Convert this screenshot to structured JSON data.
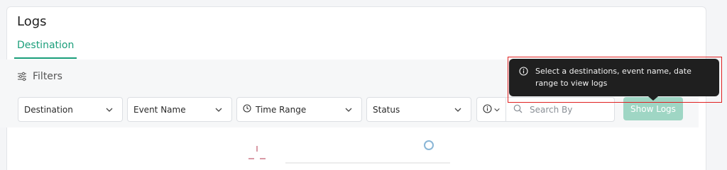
{
  "page": {
    "title": "Logs",
    "tabs": [
      {
        "label": "Destination",
        "active": true
      }
    ]
  },
  "filters": {
    "label": "Filters",
    "destination": {
      "value": "Destination"
    },
    "event_name": {
      "value": "Event Name"
    },
    "time_range": {
      "value": "Time Range"
    },
    "status": {
      "value": "Status"
    },
    "search": {
      "value": "",
      "placeholder": "Search By"
    },
    "show_logs_label": "Show Logs"
  },
  "tooltip": {
    "text": "Select a destinations, event name, date range to view logs"
  },
  "colors": {
    "accent": "#1a9e7a",
    "button_disabled": "#9fd6c4",
    "tooltip_bg": "#1f1f1f",
    "highlight": "#e02020"
  },
  "icons": [
    "sliders-icon",
    "chevron-down-icon",
    "clock-icon",
    "info-icon",
    "search-icon"
  ]
}
